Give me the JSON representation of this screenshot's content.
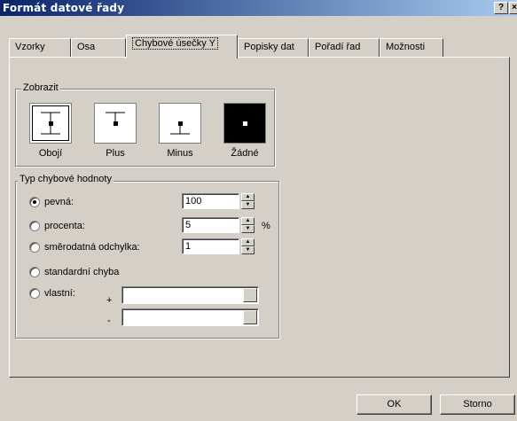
{
  "window": {
    "title": "Formát datové řady",
    "help_button": "?",
    "close_button": "×"
  },
  "tabs": [
    "Vzorky",
    "Osa",
    "Chybové úsečky Y",
    "Popisky dat",
    "Pořadí řad",
    "Možnosti"
  ],
  "active_tab": "Chybové úsečky Y",
  "display_group": {
    "label": "Zobrazit",
    "options": [
      "Obojí",
      "Plus",
      "Minus",
      "Žádné"
    ],
    "selected": "Obojí"
  },
  "value_group": {
    "label": "Typ chybové hodnoty",
    "fixed_label": "pevná:",
    "fixed_value": "100",
    "percent_label": "procenta:",
    "percent_value": "5",
    "percent_unit": "%",
    "stddev_label": "směrodatná odchylka:",
    "stddev_value": "1",
    "stderr_label": "standardní chyba",
    "custom_label": "vlastní:",
    "plus_sign": "+",
    "minus_sign": "-",
    "selected": "pevná"
  },
  "buttons": {
    "ok": "OK",
    "cancel": "Storno"
  }
}
